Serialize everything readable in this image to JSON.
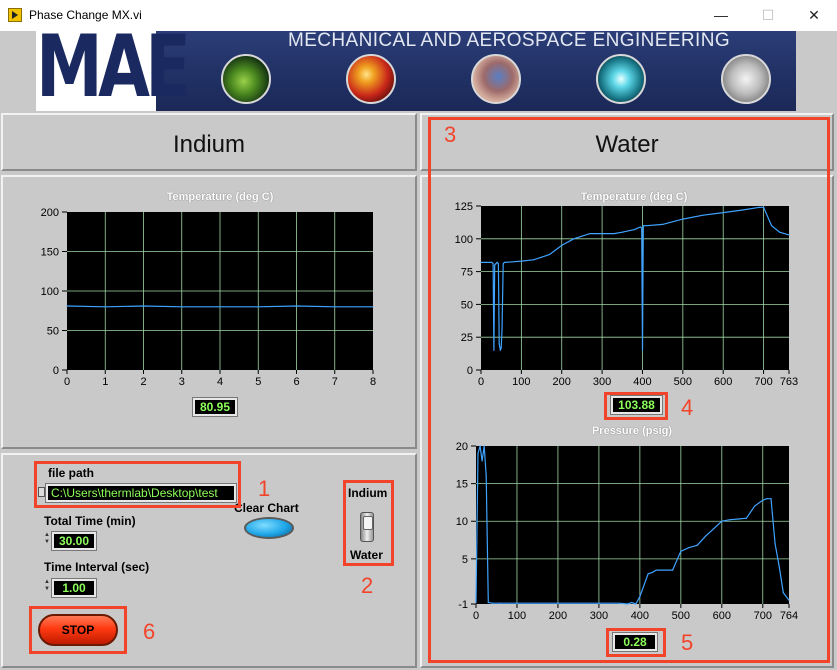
{
  "window": {
    "title": "Phase Change MX.vi",
    "minimize": "—",
    "maximize": "☐",
    "close": "✕"
  },
  "banner": {
    "logo": "MAE",
    "text": "MECHANICAL AND AEROSPACE ENGINEERING",
    "images": [
      "cone-icon",
      "bubbles-icon",
      "tissue-icon",
      "burst-icon",
      "metal-icon"
    ]
  },
  "indium": {
    "title": "Indium",
    "graph": {
      "title": "Temperature (deg C)",
      "y_ticks": [
        "200",
        "150",
        "100",
        "50",
        "0"
      ],
      "x_ticks": [
        "0",
        "1",
        "2",
        "3",
        "4",
        "5",
        "6",
        "7",
        "8"
      ]
    },
    "readout": "80.95"
  },
  "water": {
    "title": "Water",
    "temp_graph": {
      "title": "Temperature (deg C)",
      "y_ticks": [
        "125",
        "100",
        "75",
        "50",
        "25",
        "0"
      ],
      "x_ticks": [
        "0",
        "100",
        "200",
        "300",
        "400",
        "500",
        "600",
        "700",
        "763"
      ]
    },
    "temp_readout": "103.88",
    "pressure_graph": {
      "title": "Pressure (psig)",
      "y_ticks": [
        "20",
        "15",
        "10",
        "5",
        "-1"
      ],
      "x_ticks": [
        "0",
        "100",
        "200",
        "300",
        "400",
        "500",
        "600",
        "700",
        "764"
      ]
    },
    "pressure_readout": "0.28"
  },
  "controls": {
    "file_path_label": "file path",
    "file_path_value": "C:\\Users\\thermlab\\Desktop\\test",
    "clear_chart_label": "Clear Chart",
    "total_time_label": "Total Time (min)",
    "total_time_value": "30.00",
    "time_interval_label": "Time Interval (sec)",
    "time_interval_value": "1.00",
    "switch_top_label": "Indium",
    "switch_bottom_label": "Water",
    "stop_label": "STOP"
  },
  "annotations": [
    "1",
    "2",
    "3",
    "4",
    "5",
    "6"
  ],
  "colors": {
    "plot_bg": "#000000",
    "grid": "#9fd8a6",
    "trace": "#3fa3ff",
    "readout_text": "#8cff5a",
    "annotation": "#f2442a",
    "stop_button": "#ff3a12",
    "clear_button": "#1ea6e8"
  },
  "chart_data": [
    {
      "type": "line",
      "title": "Temperature (deg C)",
      "xlim": [
        0,
        8
      ],
      "ylim": [
        0,
        200
      ],
      "series": [
        {
          "x": [
            0,
            1,
            2,
            3,
            4,
            5,
            6,
            7,
            8
          ],
          "values": [
            81,
            80,
            81,
            80,
            80,
            80,
            81,
            80,
            80
          ]
        }
      ]
    },
    {
      "type": "line",
      "title": "Temperature (deg C)",
      "xlim": [
        0,
        763
      ],
      "ylim": [
        0,
        125
      ],
      "series": [
        {
          "x": [
            0,
            27,
            30,
            32,
            34,
            37,
            40,
            43,
            45,
            48,
            50,
            52,
            55,
            58,
            60,
            100,
            130,
            150,
            170,
            200,
            230,
            250,
            270,
            300,
            330,
            350,
            380,
            395,
            398,
            400,
            402,
            410,
            450,
            500,
            550,
            600,
            650,
            690,
            700,
            720,
            740,
            763
          ],
          "values": [
            82,
            82,
            81,
            15,
            80,
            81,
            82,
            81,
            20,
            15,
            17,
            30,
            81,
            82,
            82,
            83,
            84,
            86,
            88,
            95,
            100,
            102,
            104,
            104,
            104,
            105,
            107,
            109,
            108,
            15,
            110,
            110,
            111,
            115,
            118,
            120,
            122,
            124,
            124,
            110,
            105,
            103
          ]
        }
      ]
    },
    {
      "type": "line",
      "title": "Pressure (psig)",
      "xlim": [
        0,
        764
      ],
      "ylim": [
        -1,
        20
      ],
      "series": [
        {
          "x": [
            0,
            5,
            10,
            15,
            20,
            25,
            30,
            40,
            60,
            100,
            200,
            300,
            350,
            370,
            380,
            390,
            400,
            420,
            430,
            440,
            480,
            500,
            520,
            540,
            560,
            580,
            600,
            620,
            640,
            660,
            680,
            700,
            710,
            720,
            730,
            740,
            750,
            764
          ],
          "values": [
            -0.8,
            19,
            20,
            18,
            20,
            16,
            -0.8,
            -0.9,
            -0.9,
            -0.9,
            -0.9,
            -0.9,
            -0.9,
            -1,
            -0.8,
            -1,
            0,
            3,
            3.2,
            3.5,
            3.5,
            6,
            6.5,
            6.8,
            8,
            9,
            10,
            10.2,
            10.3,
            10.4,
            12,
            12.8,
            13,
            13,
            7,
            4,
            0.5,
            -0.5
          ]
        }
      ]
    }
  ]
}
